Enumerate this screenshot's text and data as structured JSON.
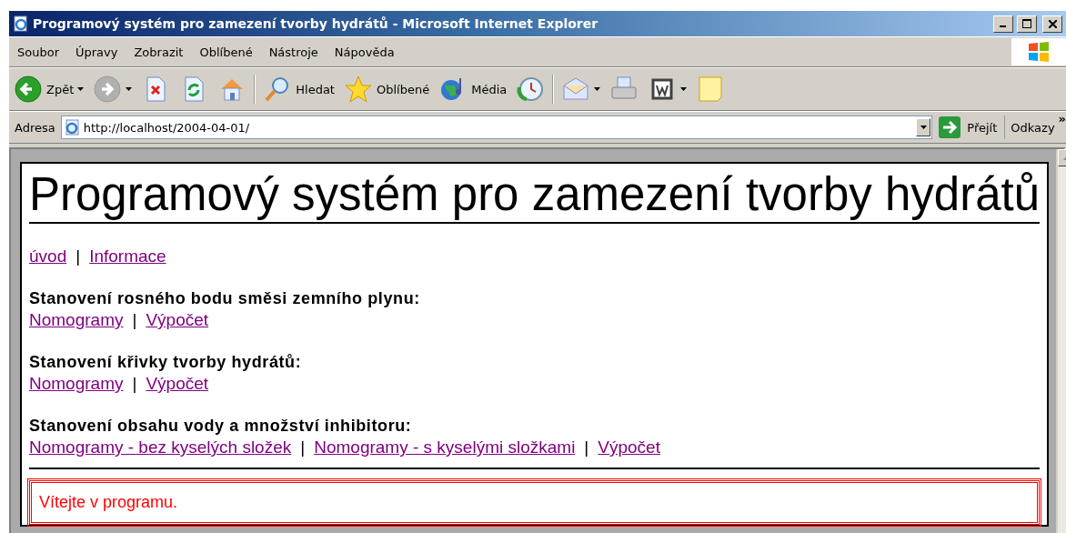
{
  "window": {
    "title": "Programový systém pro zamezení tvorby hydrátů - Microsoft Internet Explorer"
  },
  "menu": [
    "Soubor",
    "Úpravy",
    "Zobrazit",
    "Oblíbené",
    "Nástroje",
    "Nápověda"
  ],
  "toolbar": [
    {
      "kind": "back",
      "label": "Zpět",
      "dropdown": true,
      "disabled": false
    },
    {
      "kind": "forward",
      "dropdown": true,
      "disabled": true
    },
    {
      "kind": "stop",
      "dropdown": false,
      "disabled": false
    },
    {
      "kind": "refresh",
      "dropdown": false,
      "disabled": false
    },
    {
      "kind": "home",
      "dropdown": false,
      "disabled": false
    },
    {
      "kind": "separator"
    },
    {
      "kind": "search",
      "label": "Hledat",
      "dropdown": false,
      "disabled": false
    },
    {
      "kind": "favorites",
      "label": "Oblíbené",
      "dropdown": false,
      "disabled": false
    },
    {
      "kind": "media",
      "label": "Média",
      "dropdown": false,
      "disabled": false
    },
    {
      "kind": "history",
      "dropdown": false,
      "disabled": false
    },
    {
      "kind": "separator"
    },
    {
      "kind": "mail",
      "dropdown": true,
      "disabled": false
    },
    {
      "kind": "print",
      "dropdown": false,
      "disabled": false
    },
    {
      "kind": "word",
      "dropdown": true,
      "disabled": false
    },
    {
      "kind": "note",
      "dropdown": false,
      "disabled": false
    }
  ],
  "address": {
    "label": "Adresa",
    "value": "http://localhost/2004-04-01/",
    "go": "Přejít",
    "links": "Odkazy",
    "more": "»"
  },
  "page": {
    "heading": "Programový systém pro zamezení tvorby hydrátů",
    "nav": [
      {
        "kind": "link",
        "text": "úvod"
      },
      {
        "kind": "separator",
        "text": "|"
      },
      {
        "kind": "link",
        "text": "Informace"
      }
    ],
    "sections": [
      {
        "title": "Stanovení rosného bodu směsi zemního plynu:",
        "links": [
          {
            "kind": "link",
            "text": "Nomogramy"
          },
          {
            "kind": "separator",
            "text": "|"
          },
          {
            "kind": "link",
            "text": "Výpočet"
          }
        ]
      },
      {
        "title": "Stanovení křivky tvorby hydrátů:",
        "links": [
          {
            "kind": "link",
            "text": "Nomogramy"
          },
          {
            "kind": "separator",
            "text": "|"
          },
          {
            "kind": "link",
            "text": "Výpočet"
          }
        ]
      },
      {
        "title": "Stanovení obsahu vody a množství inhibitoru:",
        "links": [
          {
            "kind": "link",
            "text": "Nomogramy - bez kyselých složek"
          },
          {
            "kind": "separator",
            "text": "|"
          },
          {
            "kind": "link",
            "text": "Nomogramy - s kyselými složkami"
          },
          {
            "kind": "separator",
            "text": "|"
          },
          {
            "kind": "link",
            "text": "Výpočet"
          }
        ]
      }
    ],
    "message": "Vítejte v programu."
  }
}
